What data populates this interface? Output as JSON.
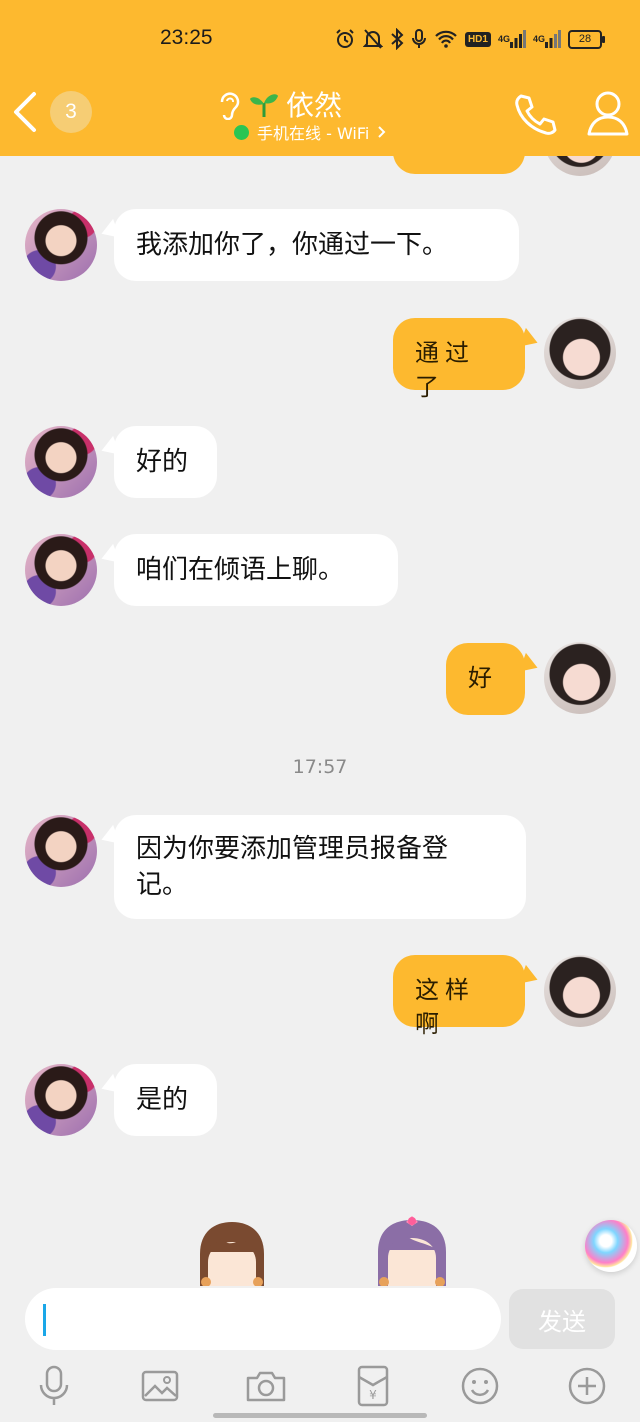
{
  "status_bar": {
    "time": "23:25",
    "hd": "HD1",
    "signal1": "4G",
    "signal2": "4G",
    "battery": "28",
    "icons": [
      "alarm-icon",
      "mute-icon",
      "bluetooth-icon",
      "mic-icon",
      "wifi-icon"
    ]
  },
  "header": {
    "unread_count": "3",
    "contact_name": "依然",
    "status_text": "手机在线 - WiFi",
    "accent": "#fdb92f"
  },
  "messages": [
    {
      "side": "left",
      "text": "我添加你了，你通过一下。"
    },
    {
      "side": "right",
      "text": "通过了"
    },
    {
      "side": "left",
      "text": "好的"
    },
    {
      "side": "left",
      "text": "咱们在倾语上聊。"
    },
    {
      "side": "right",
      "text": "好"
    },
    {
      "side": "left",
      "text_line1": "因为你要添加管理员报备登",
      "text_line2": "记。"
    },
    {
      "side": "right",
      "text": "这样啊"
    },
    {
      "side": "left",
      "text": "是的"
    }
  ],
  "timestamp": "17:57",
  "input": {
    "value": "",
    "send_label": "发送"
  },
  "toolbar": {
    "icons": [
      "mic-icon",
      "image-icon",
      "camera-icon",
      "red-packet-icon",
      "emoji-icon",
      "plus-icon"
    ]
  }
}
